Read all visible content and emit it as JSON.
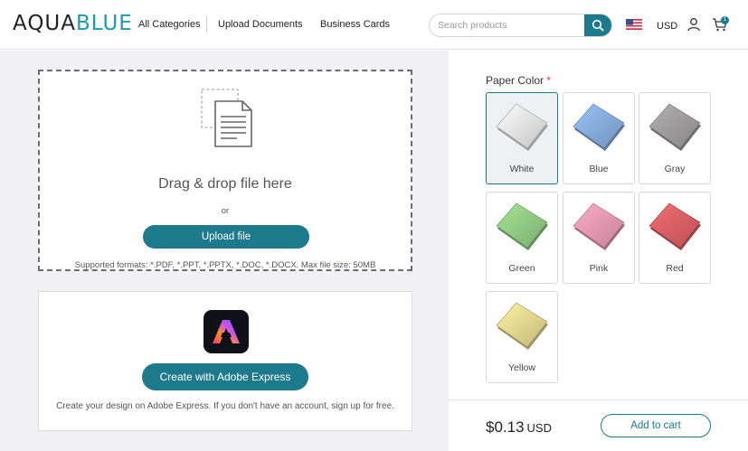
{
  "header": {
    "logo_part1": "AQUA",
    "logo_part2": "BLUE",
    "nav": [
      "All Categories",
      "Upload Documents",
      "Business Cards"
    ],
    "search_placeholder": "Search products",
    "currency": "USD",
    "cart_count": "1",
    "icons": {
      "search": "search-icon",
      "flag": "us-flag-icon",
      "user": "user-icon",
      "cart": "cart-icon"
    }
  },
  "upload": {
    "title": "Drag & drop file here",
    "or": "or",
    "button": "Upload file",
    "formats": "Supported formats: *.PDF, *.PPT, *.PPTX, *.DOC, *.DOCX. Max file size: 50MB"
  },
  "express": {
    "button": "Create with Adobe Express",
    "note": "Create your design on Adobe Express. If you don't have an account, sign up for free."
  },
  "paper": {
    "label": "Paper Color",
    "required_mark": "*",
    "selected": "White",
    "colors": [
      {
        "name": "White",
        "hex": "#f4f4f4"
      },
      {
        "name": "Blue",
        "hex": "#8fb8ea"
      },
      {
        "name": "Gray",
        "hex": "#a9a7a7"
      },
      {
        "name": "Green",
        "hex": "#9bd88c"
      },
      {
        "name": "Pink",
        "hex": "#f4a3bd"
      },
      {
        "name": "Red",
        "hex": "#e7666b"
      },
      {
        "name": "Yellow",
        "hex": "#f1e59a"
      }
    ]
  },
  "cart": {
    "price": "$0.13",
    "currency": "USD",
    "button": "Add to cart"
  },
  "colors": {
    "accent": "#1d7a8c",
    "logo_blue": "#1a9ab3",
    "panel_bg": "#f1f1f3"
  }
}
